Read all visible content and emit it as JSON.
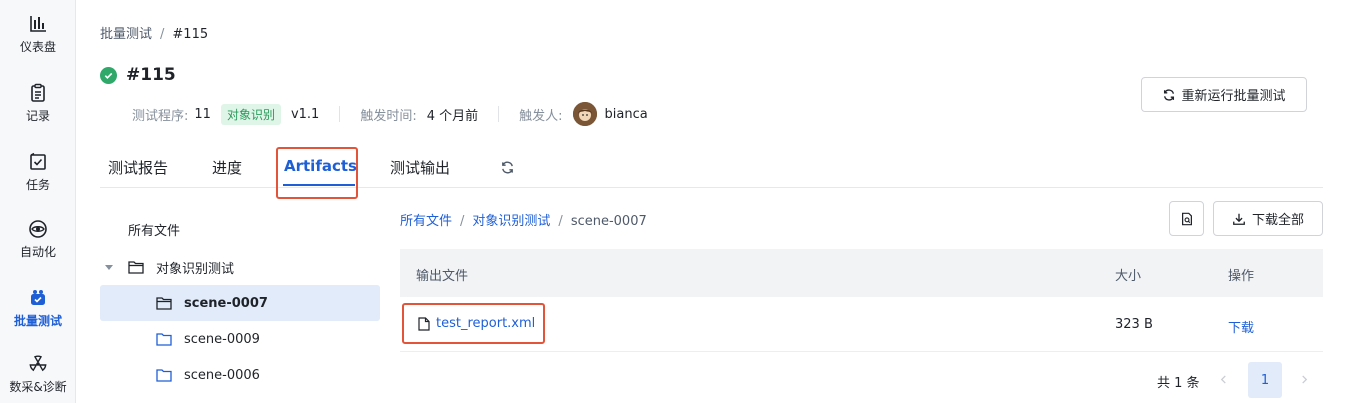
{
  "nav": {
    "items": [
      {
        "label": "仪表盘",
        "icon": "bar-chart-icon"
      },
      {
        "label": "记录",
        "icon": "clipboard-icon"
      },
      {
        "label": "任务",
        "icon": "task-check-icon"
      },
      {
        "label": "自动化",
        "icon": "automation-eye-icon"
      },
      {
        "label": "批量测试",
        "icon": "batch-test-icon",
        "active": true
      },
      {
        "label": "数采&诊断",
        "icon": "radiation-icon"
      }
    ]
  },
  "breadcrumb": {
    "parent": "批量测试",
    "separator": "/",
    "current": "#115"
  },
  "header": {
    "title": "#115",
    "status": "success",
    "program_label": "测试程序:",
    "program_id": "11",
    "program_tag": "对象识别",
    "program_version": "v1.1",
    "trigger_time_label": "触发时间:",
    "trigger_time_value": "4 个月前",
    "trigger_user_label": "触发人:",
    "trigger_user_value": "bianca",
    "rerun_button": "重新运行批量测试"
  },
  "tabs": [
    {
      "label": "测试报告"
    },
    {
      "label": "进度"
    },
    {
      "label": "Artifacts",
      "active": true
    },
    {
      "label": "测试输出"
    }
  ],
  "tree": {
    "root": "所有文件",
    "folder": "对象识别测试",
    "children": [
      "scene-0007",
      "scene-0009",
      "scene-0006"
    ],
    "selected": "scene-0007"
  },
  "files": {
    "breadcrumb": [
      "所有文件",
      "对象识别测试",
      "scene-0007"
    ],
    "download_all": "下载全部",
    "columns": {
      "name": "输出文件",
      "size": "大小",
      "action": "操作"
    },
    "rows": [
      {
        "name": "test_report.xml",
        "size": "323 B",
        "action": "下载"
      }
    ],
    "total": "共 1 条",
    "page": "1"
  },
  "colors": {
    "accent": "#1f5fd6",
    "success": "#2fa86a",
    "highlight": "#e2553a"
  }
}
